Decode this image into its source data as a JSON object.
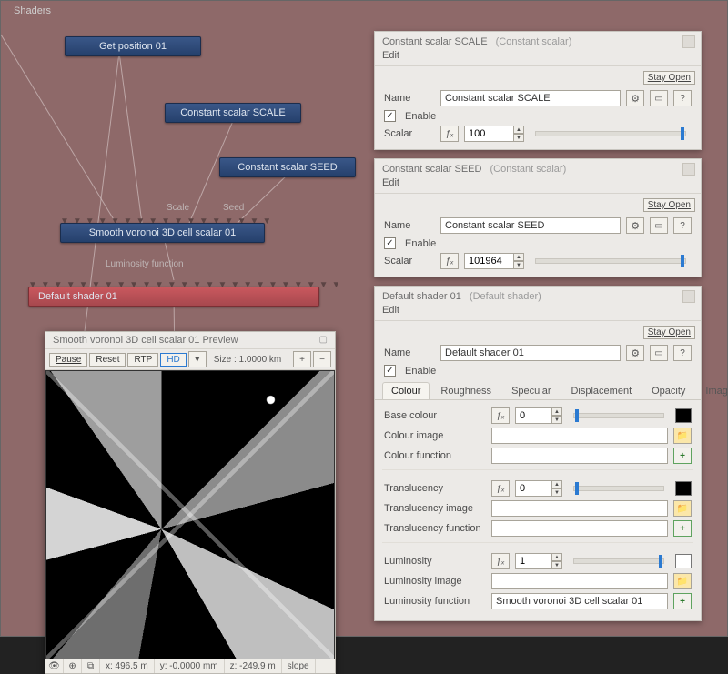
{
  "tab_title": "Shaders",
  "nodes": {
    "get_position": "Get position 01",
    "scale_const": "Constant scalar SCALE",
    "seed_const": "Constant scalar SEED",
    "voronoi": "Smooth voronoi 3D cell scalar 01",
    "default_shader": "Default shader 01"
  },
  "edge_labels": {
    "scale": "Scale",
    "seed": "Seed",
    "lum": "Luminosity function"
  },
  "panel_scale": {
    "title": "Constant scalar SCALE",
    "subtitle": "(Constant scalar)",
    "edit": "Edit",
    "stay_open": "Stay Open",
    "name_label": "Name",
    "name_value": "Constant scalar SCALE",
    "enable_label": "Enable",
    "scalar_label": "Scalar",
    "scalar_value": "100"
  },
  "panel_seed": {
    "title": "Constant scalar SEED",
    "subtitle": "(Constant scalar)",
    "edit": "Edit",
    "stay_open": "Stay Open",
    "name_label": "Name",
    "name_value": "Constant scalar SEED",
    "enable_label": "Enable",
    "scalar_label": "Scalar",
    "scalar_value": "101964"
  },
  "panel_shader": {
    "title": "Default shader 01",
    "subtitle": "(Default shader)",
    "edit": "Edit",
    "stay_open": "Stay Open",
    "name_label": "Name",
    "name_value": "Default shader 01",
    "enable_label": "Enable",
    "tabs": [
      "Colour",
      "Roughness",
      "Specular",
      "Displacement",
      "Opacity",
      "Images"
    ],
    "rows": {
      "base_colour": {
        "label": "Base colour",
        "value": "0"
      },
      "colour_image": {
        "label": "Colour image",
        "value": ""
      },
      "colour_function": {
        "label": "Colour function",
        "value": ""
      },
      "translucency": {
        "label": "Translucency",
        "value": "0"
      },
      "translucency_image": {
        "label": "Translucency image",
        "value": ""
      },
      "translucency_function": {
        "label": "Translucency function",
        "value": ""
      },
      "luminosity": {
        "label": "Luminosity",
        "value": "1"
      },
      "luminosity_image": {
        "label": "Luminosity image",
        "value": ""
      },
      "luminosity_function": {
        "label": "Luminosity function",
        "value": "Smooth voronoi 3D cell scalar 01"
      }
    }
  },
  "preview": {
    "title": "Smooth voronoi 3D cell scalar 01 Preview",
    "buttons": {
      "pause": "Pause",
      "reset": "Reset",
      "rtp": "RTP",
      "hd": "HD"
    },
    "size_label": "Size : 1.0000 km",
    "status": {
      "x": "x: 496.5 m",
      "y": "y: -0.0000 mm",
      "z": "z: -249.9 m",
      "slope": "slope"
    }
  }
}
